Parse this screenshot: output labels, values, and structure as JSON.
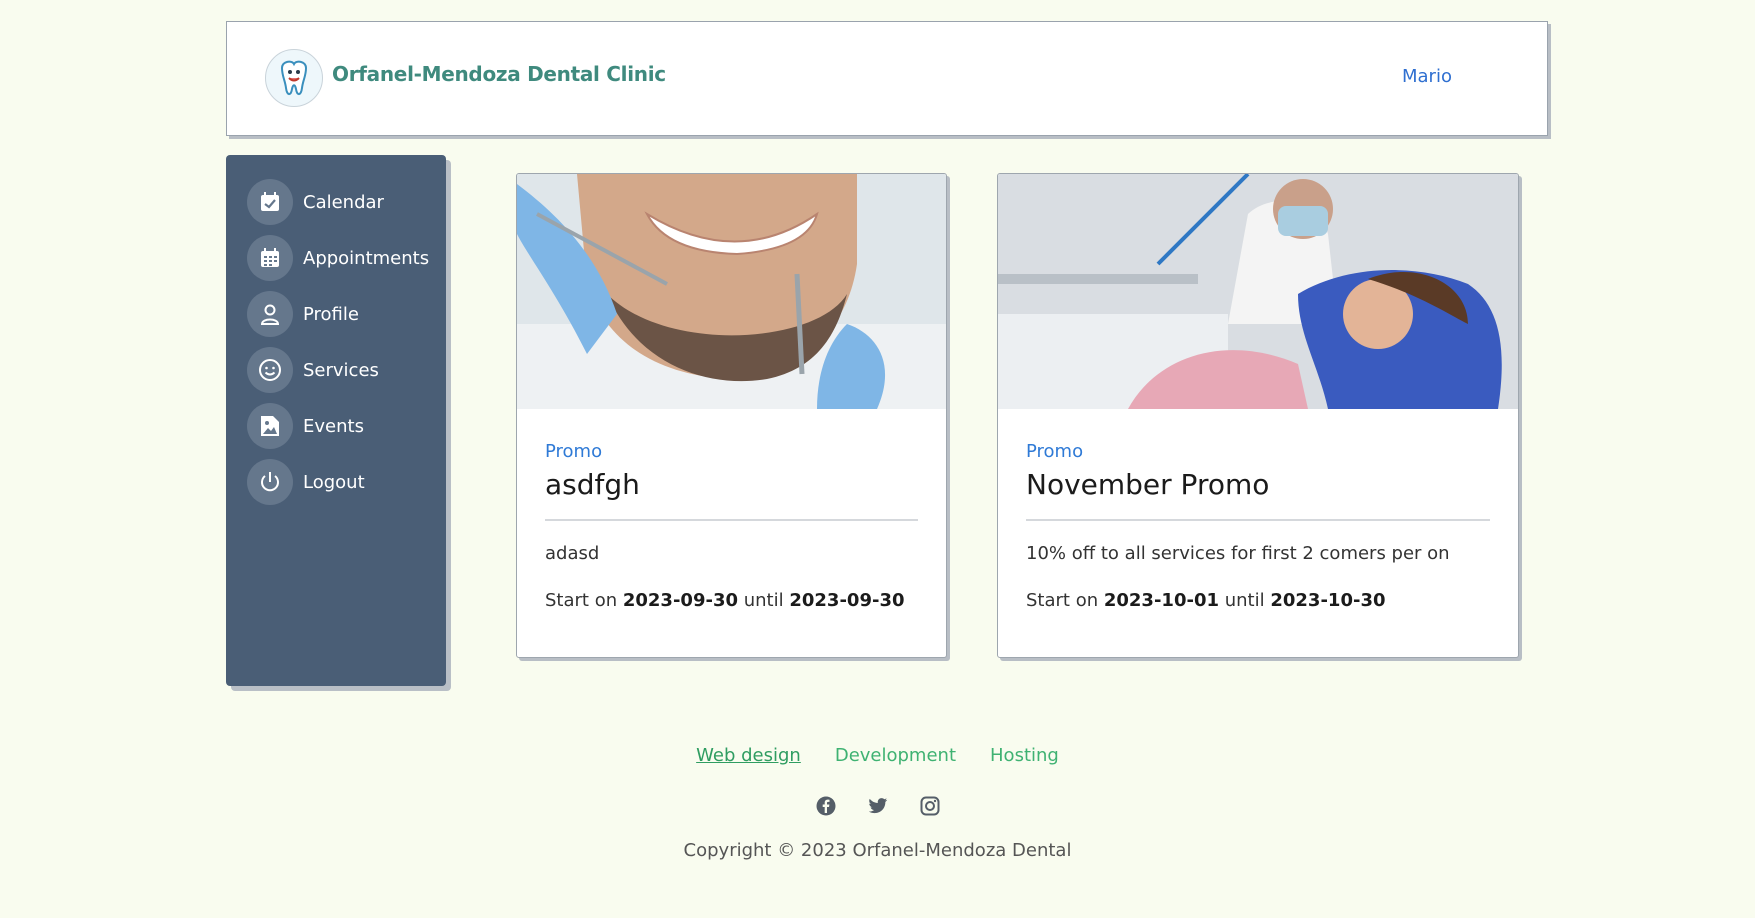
{
  "header": {
    "brand": "Orfanel-Mendoza Dental Clinic",
    "user": "Mario"
  },
  "sidebar": {
    "items": [
      {
        "label": "Calendar",
        "icon": "calendar-check-icon"
      },
      {
        "label": "Appointments",
        "icon": "calendar-grid-icon"
      },
      {
        "label": "Profile",
        "icon": "user-icon"
      },
      {
        "label": "Services",
        "icon": "smile-icon"
      },
      {
        "label": "Events",
        "icon": "image-file-icon"
      },
      {
        "label": "Logout",
        "icon": "power-icon"
      }
    ]
  },
  "cards": [
    {
      "tag": "Promo",
      "title": "asdfgh",
      "description": "adasd",
      "start_prefix": "Start on",
      "start": "2023-09-30",
      "until_word": "until",
      "end": "2023-09-30"
    },
    {
      "tag": "Promo",
      "title": "November Promo",
      "description": "10% off to all services for first 2 comers per on",
      "start_prefix": "Start on",
      "start": "2023-10-01",
      "until_word": "until",
      "end": "2023-10-30"
    }
  ],
  "footer": {
    "links": [
      "Web design",
      "Development",
      "Hosting"
    ],
    "socials": [
      "facebook-icon",
      "twitter-icon",
      "instagram-icon"
    ],
    "copyright": "Copyright © 2023 Orfanel-Mendoza Dental"
  },
  "colors": {
    "background": "#f9fcef",
    "sidebar": "#4a5e76",
    "accent_blue": "#2f7ad6",
    "footer_green": "#3fb272",
    "brand_teal": "#3f8a7e"
  }
}
